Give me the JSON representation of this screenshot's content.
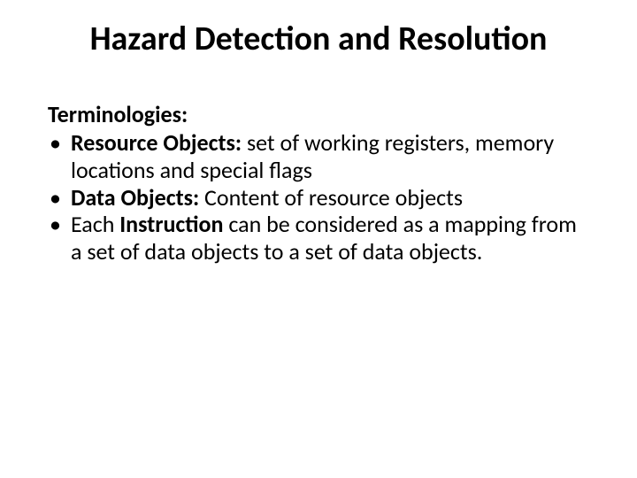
{
  "title": "Hazard Detection and Resolution",
  "subhead": "Terminologies:",
  "items": [
    {
      "term": "Resource Objects: ",
      "desc": "set of working registers, memory locations and special flags"
    },
    {
      "term": "Data Objects: ",
      "desc": "Content of resource objects"
    },
    {
      "term": "",
      "pre": "Each ",
      "termmid": "Instruction",
      "desc": " can be considered as a mapping from a set of data objects to a set of data objects."
    }
  ]
}
